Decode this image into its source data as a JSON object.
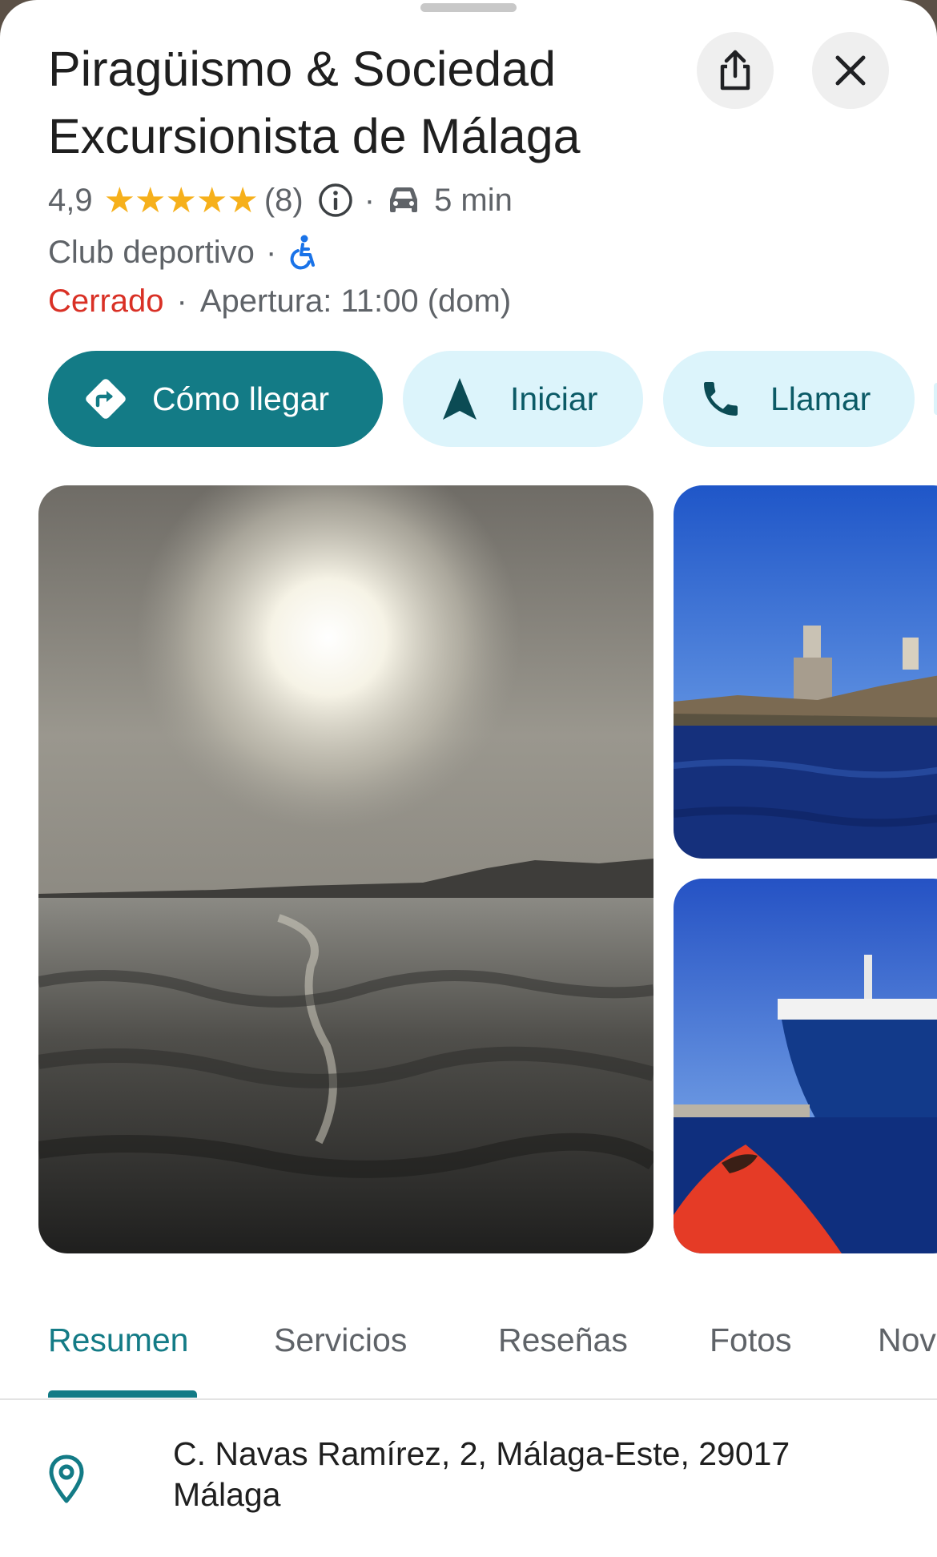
{
  "place": {
    "title": "Piragüismo & Sociedad Excursionista de Málaga",
    "rating": "4,9",
    "stars_count": 5,
    "review_count": "(8)",
    "separator": "·",
    "drive_time": "5 min",
    "category": "Club deportivo",
    "status": "Cerrado",
    "opening": "Apertura: 11:00 (dom)",
    "address": "C. Navas Ramírez, 2, Málaga-Este, 29017 Málaga"
  },
  "header_actions": {
    "share_icon": "share-icon",
    "close_icon": "close-icon"
  },
  "actions": {
    "directions": "Cómo llegar",
    "start": "Iniciar",
    "call": "Llamar"
  },
  "tabs": [
    "Resumen",
    "Servicios",
    "Reseñas",
    "Fotos",
    "Nov"
  ],
  "colors": {
    "accent": "#137b86",
    "secondary_button_bg": "#dcf4fb",
    "closed_red": "#d93025",
    "star_yellow": "#f6b01b",
    "accessibility_blue": "#1a73e8"
  }
}
